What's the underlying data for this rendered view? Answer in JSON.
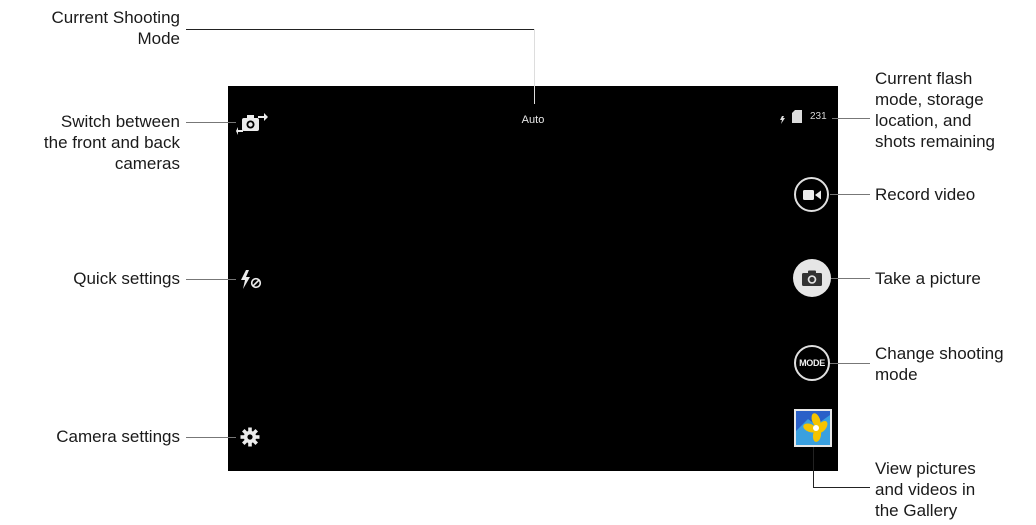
{
  "callouts": {
    "shooting_mode": "Current Shooting\nMode",
    "switch_camera": "Switch between\nthe front and back\ncameras",
    "quick_settings": "Quick settings",
    "camera_settings": "Camera settings",
    "flash_storage": "Current flash\nmode, storage\nlocation, and\nshots remaining",
    "record_video": "Record video",
    "take_picture": "Take a picture",
    "change_mode": "Change shooting\nmode",
    "gallery": "View pictures\nand videos in\nthe Gallery"
  },
  "screen": {
    "mode_label": "Auto",
    "shots_remaining": "231",
    "mode_button_label": "MODE"
  },
  "icons": {
    "switch_camera": "switch-camera-icon",
    "flash_off": "flash-off-icon",
    "settings": "gear-icon",
    "flash_status": "flash-status-icon",
    "storage": "sd-card-icon",
    "video": "video-camera-icon",
    "shutter": "camera-icon",
    "gallery": "gallery-thumbnail-icon"
  },
  "colors": {
    "screen_background": "#000000",
    "shutter_fill": "#e6e6e6",
    "gallery_thumb": "#2a60c8"
  }
}
